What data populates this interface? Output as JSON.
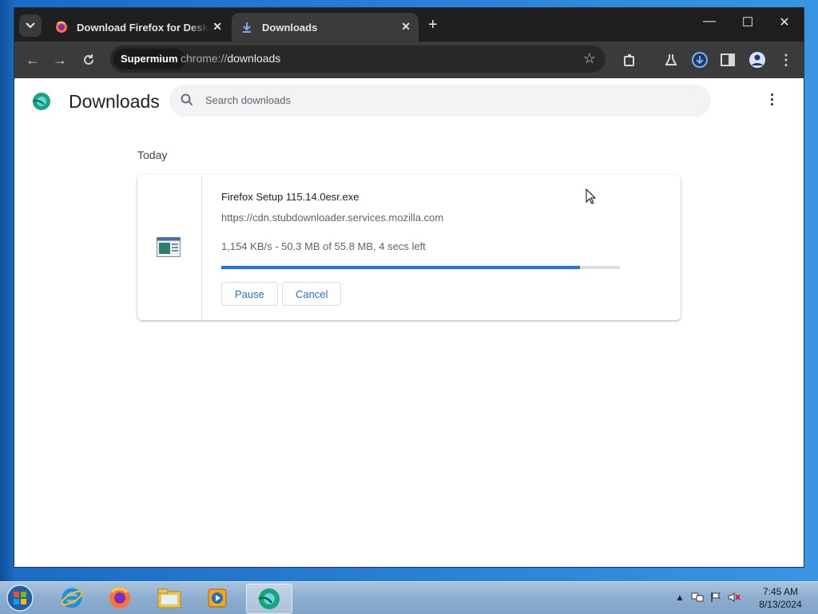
{
  "browser": {
    "tabs": [
      {
        "label": "Download Firefox for Desktop — Mozilla",
        "active": false
      },
      {
        "label": "Downloads",
        "active": true
      }
    ],
    "toolbar": {
      "browser_chip": "Supermium",
      "url_scheme": "chrome://",
      "url_host": "downloads"
    }
  },
  "page": {
    "title": "Downloads",
    "search_placeholder": "Search downloads",
    "date_heading": "Today",
    "download": {
      "file_name": "Firefox Setup 115.14.0esr.exe",
      "source_url": "https://cdn.stubdownloader.services.mozilla.com",
      "status": "1,154 KB/s - 50.3 MB of 55.8 MB, 4 secs left",
      "progress_fraction": 0.9,
      "pause_label": "Pause",
      "cancel_label": "Cancel"
    }
  },
  "taskbar": {
    "apps": [
      "internet-explorer-icon",
      "firefox-icon",
      "file-explorer-icon",
      "media-player-icon",
      "supermium-icon"
    ],
    "clock_time": "7:45 AM",
    "clock_date": "8/13/2024"
  },
  "colors": {
    "accent": "#1a73e8",
    "tabstrip": "#1f1f1f",
    "toolbar": "#3b3b3b"
  }
}
